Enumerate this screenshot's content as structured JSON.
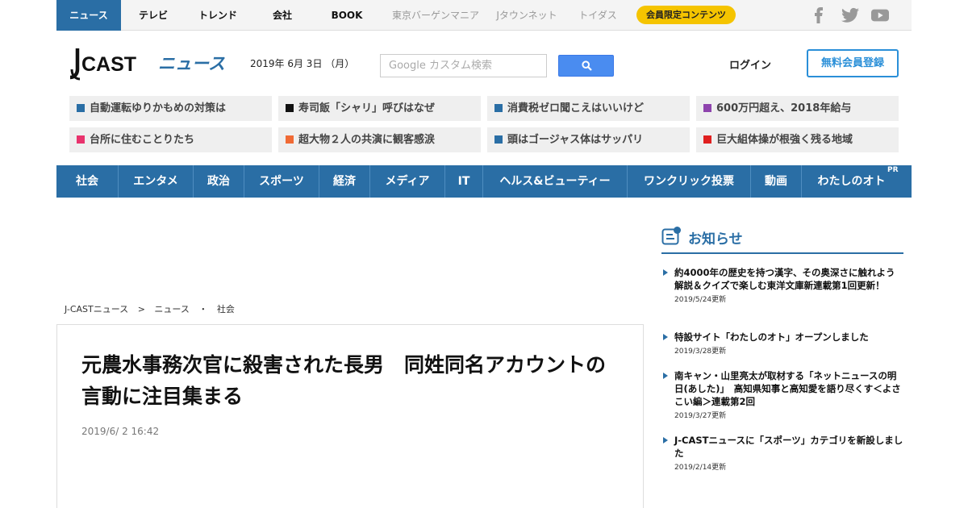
{
  "topbar": {
    "tabs": [
      {
        "label": "ニュース",
        "active": true
      },
      {
        "label": "テレビ"
      },
      {
        "label": "トレンド"
      },
      {
        "label": "会社"
      },
      {
        "label": "BOOK"
      },
      {
        "label": "東京バーゲンマニア",
        "muted": true
      },
      {
        "label": "Jタウンネット",
        "muted": true
      },
      {
        "label": "トイダス",
        "muted": true
      }
    ],
    "members_pill": "会員限定コンテンツ",
    "social_icons": [
      "facebook-icon",
      "twitter-icon",
      "youtube-icon"
    ]
  },
  "header": {
    "logo_text": "CAST",
    "logo_sub": "ニュース",
    "date": "2019年 6月 3日 （月）",
    "search_placeholder": "Google カスタム検索",
    "login_label": "ログイン",
    "register_label": "無料会員登録"
  },
  "trending": [
    {
      "label": "自動運転ゆりかもめの対策は",
      "color": "#2a6ea5"
    },
    {
      "label": "寿司飯「シャリ」呼びはなぜ",
      "color": "#111111"
    },
    {
      "label": "消費税ゼロ聞こえはいいけど",
      "color": "#2a6ea5"
    },
    {
      "label": "600万円超え、2018年給与",
      "color": "#8e44ad"
    },
    {
      "label": "台所に住むことりたち",
      "color": "#e8336d"
    },
    {
      "label": "超大物２人の共演に観客感涙",
      "color": "#f06a35"
    },
    {
      "label": "頭はゴージャス体はサッパリ",
      "color": "#2a6ea5"
    },
    {
      "label": "巨大組体操が根強く残る地域",
      "color": "#e02020"
    }
  ],
  "categories": [
    "社会",
    "エンタメ",
    "政治",
    "スポーツ",
    "経済",
    "メディア",
    "IT",
    "ヘルス&ビューティー",
    "ワンクリック投票",
    "動画",
    "わたしのオト"
  ],
  "categories_pr": "PR",
  "breadcrumb": [
    "J-CASTニュース",
    ">",
    "ニュース",
    "・",
    "社会"
  ],
  "article": {
    "title": "元農水事務次官に殺害された長男　同姓同名アカウントの言動に注目集まる",
    "date": "2019/6/ 2 16:42"
  },
  "notices": {
    "title": "お知らせ",
    "items": [
      {
        "text": "約4000年の歴史を持つ漢字、その奥深さに触れよう　解説＆クイズで楽しむ東洋文庫新連載第1回更新！",
        "date": "2019/5/24更新"
      },
      {
        "text": "特設サイト「わたしのオト」オープンしました",
        "date": "2019/3/28更新"
      },
      {
        "text": "南キャン・山里亮太が取材する「ネットニュースの明日(あした)」　高知県知事と高知愛を語り尽くす＜よさこい編＞連載第2回",
        "date": "2019/3/27更新"
      },
      {
        "text": "J-CASTニュースに「スポーツ」カテゴリを新設しました",
        "date": "2019/2/14更新"
      }
    ]
  },
  "colors": {
    "brand": "#2a6ea5",
    "accent": "#2a8fd8",
    "pill": "#f5c400"
  }
}
